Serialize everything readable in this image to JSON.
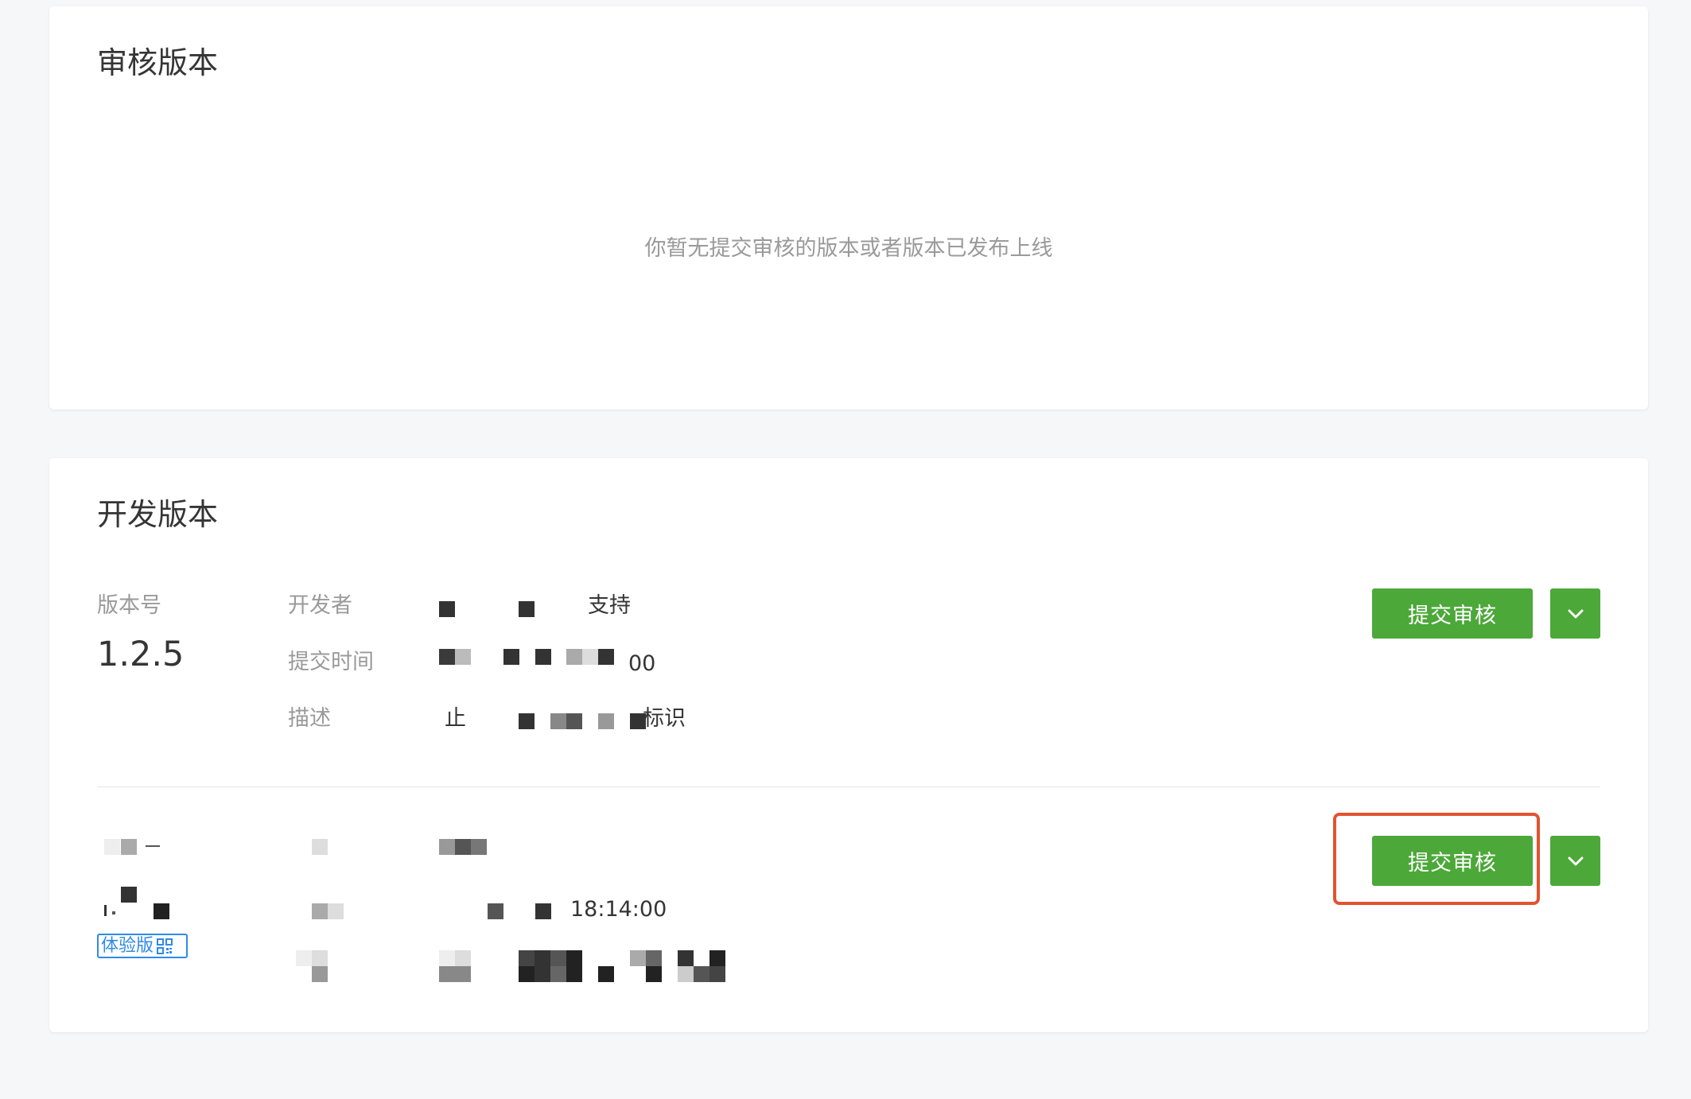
{
  "review_section": {
    "title": "审核版本",
    "empty_text": "你暂无提交审核的版本或者版本已发布上线"
  },
  "dev_section": {
    "title": "开发版本",
    "labels": {
      "version": "版本号",
      "developer": "开发者",
      "submit_time": "提交时间",
      "description": "描述"
    },
    "versions": [
      {
        "version": "1.2.5",
        "developer_fragment": "支持",
        "submit_time_fragment": "00",
        "description_fragments": [
          "止",
          "标识"
        ],
        "submit_button": "提交审核",
        "more_icon": "chevron-down-icon"
      },
      {
        "submit_time_fragment": "18:14:00",
        "badge": "体验版",
        "badge_icon": "qr-code-icon",
        "submit_button": "提交审核",
        "more_icon": "chevron-down-icon"
      }
    ]
  },
  "colors": {
    "accent": "#4ca839",
    "highlight": "#e2532f",
    "badge": "#2f8ae6"
  }
}
